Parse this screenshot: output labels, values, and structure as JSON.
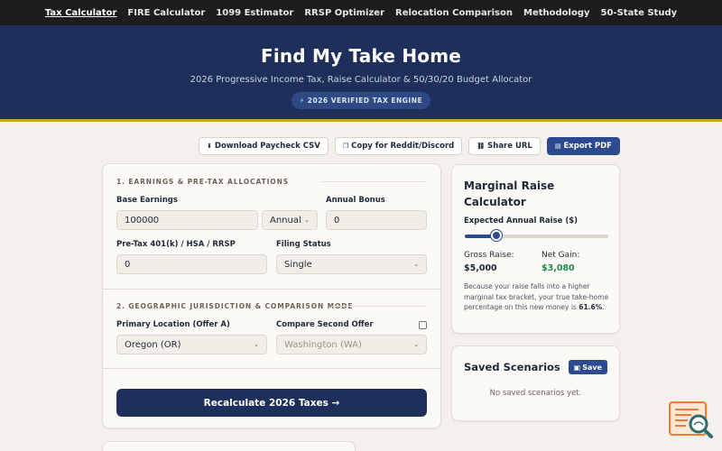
{
  "nav": {
    "items": [
      {
        "label": "Tax Calculator",
        "active": true
      },
      {
        "label": "FIRE Calculator"
      },
      {
        "label": "1099 Estimator"
      },
      {
        "label": "RRSP Optimizer"
      },
      {
        "label": "Relocation Comparison"
      },
      {
        "label": "Methodology"
      },
      {
        "label": "50-State Study"
      }
    ]
  },
  "hero": {
    "title": "Find My Take Home",
    "subtitle": "2026 Progressive Income Tax, Raise Calculator & 50/30/20 Budget Allocator",
    "badge": "⚡ 2026 VERIFIED TAX ENGINE"
  },
  "toolbar": {
    "download_csv": "Download Paycheck CSV",
    "copy_reddit": "Copy for Reddit/Discord",
    "share_url": "Share URL",
    "export_pdf": "Export PDF"
  },
  "section1": {
    "title": "1. EARNINGS & PRE-TAX ALLOCATIONS",
    "base_earnings_label": "Base Earnings",
    "base_earnings_value": "100000",
    "period_value": "Annual",
    "bonus_label": "Annual Bonus",
    "bonus_value": "0",
    "pretax_label": "Pre-Tax 401(k) / HSA / RRSP",
    "pretax_value": "0",
    "filing_label": "Filing Status",
    "filing_value": "Single"
  },
  "section2": {
    "title": "2. GEOGRAPHIC JURISDICTION & COMPARISON MODE",
    "primary_label": "Primary Location (Offer A)",
    "primary_value": "Oregon (OR)",
    "compare_label": "Compare Second Offer",
    "compare_value": "Washington (WA)",
    "compare_checked": false
  },
  "recalc_label": "Recalculate 2026 Taxes →",
  "raise": {
    "title": "Marginal Raise Calculator",
    "slider_label": "Expected Annual Raise ($)",
    "slider_fraction": 0.22,
    "gross_label": "Gross Raise:",
    "gross_value": "$5,000",
    "net_label": "Net Gain:",
    "net_value": "$3,080",
    "explain_text": "Because your raise falls into a higher marginal tax bracket, your true take-home percentage on this new money is ",
    "explain_pct": "61.6%",
    "explain_end": "."
  },
  "saved": {
    "title": "Saved Scenarios",
    "save_label": "Save",
    "empty_text": "No saved scenarios yet."
  },
  "colors": {
    "navy": "#1d2f5a",
    "blue": "#2b4a8f",
    "net_green": "#1f8a4c",
    "gold": "#c9a227"
  }
}
